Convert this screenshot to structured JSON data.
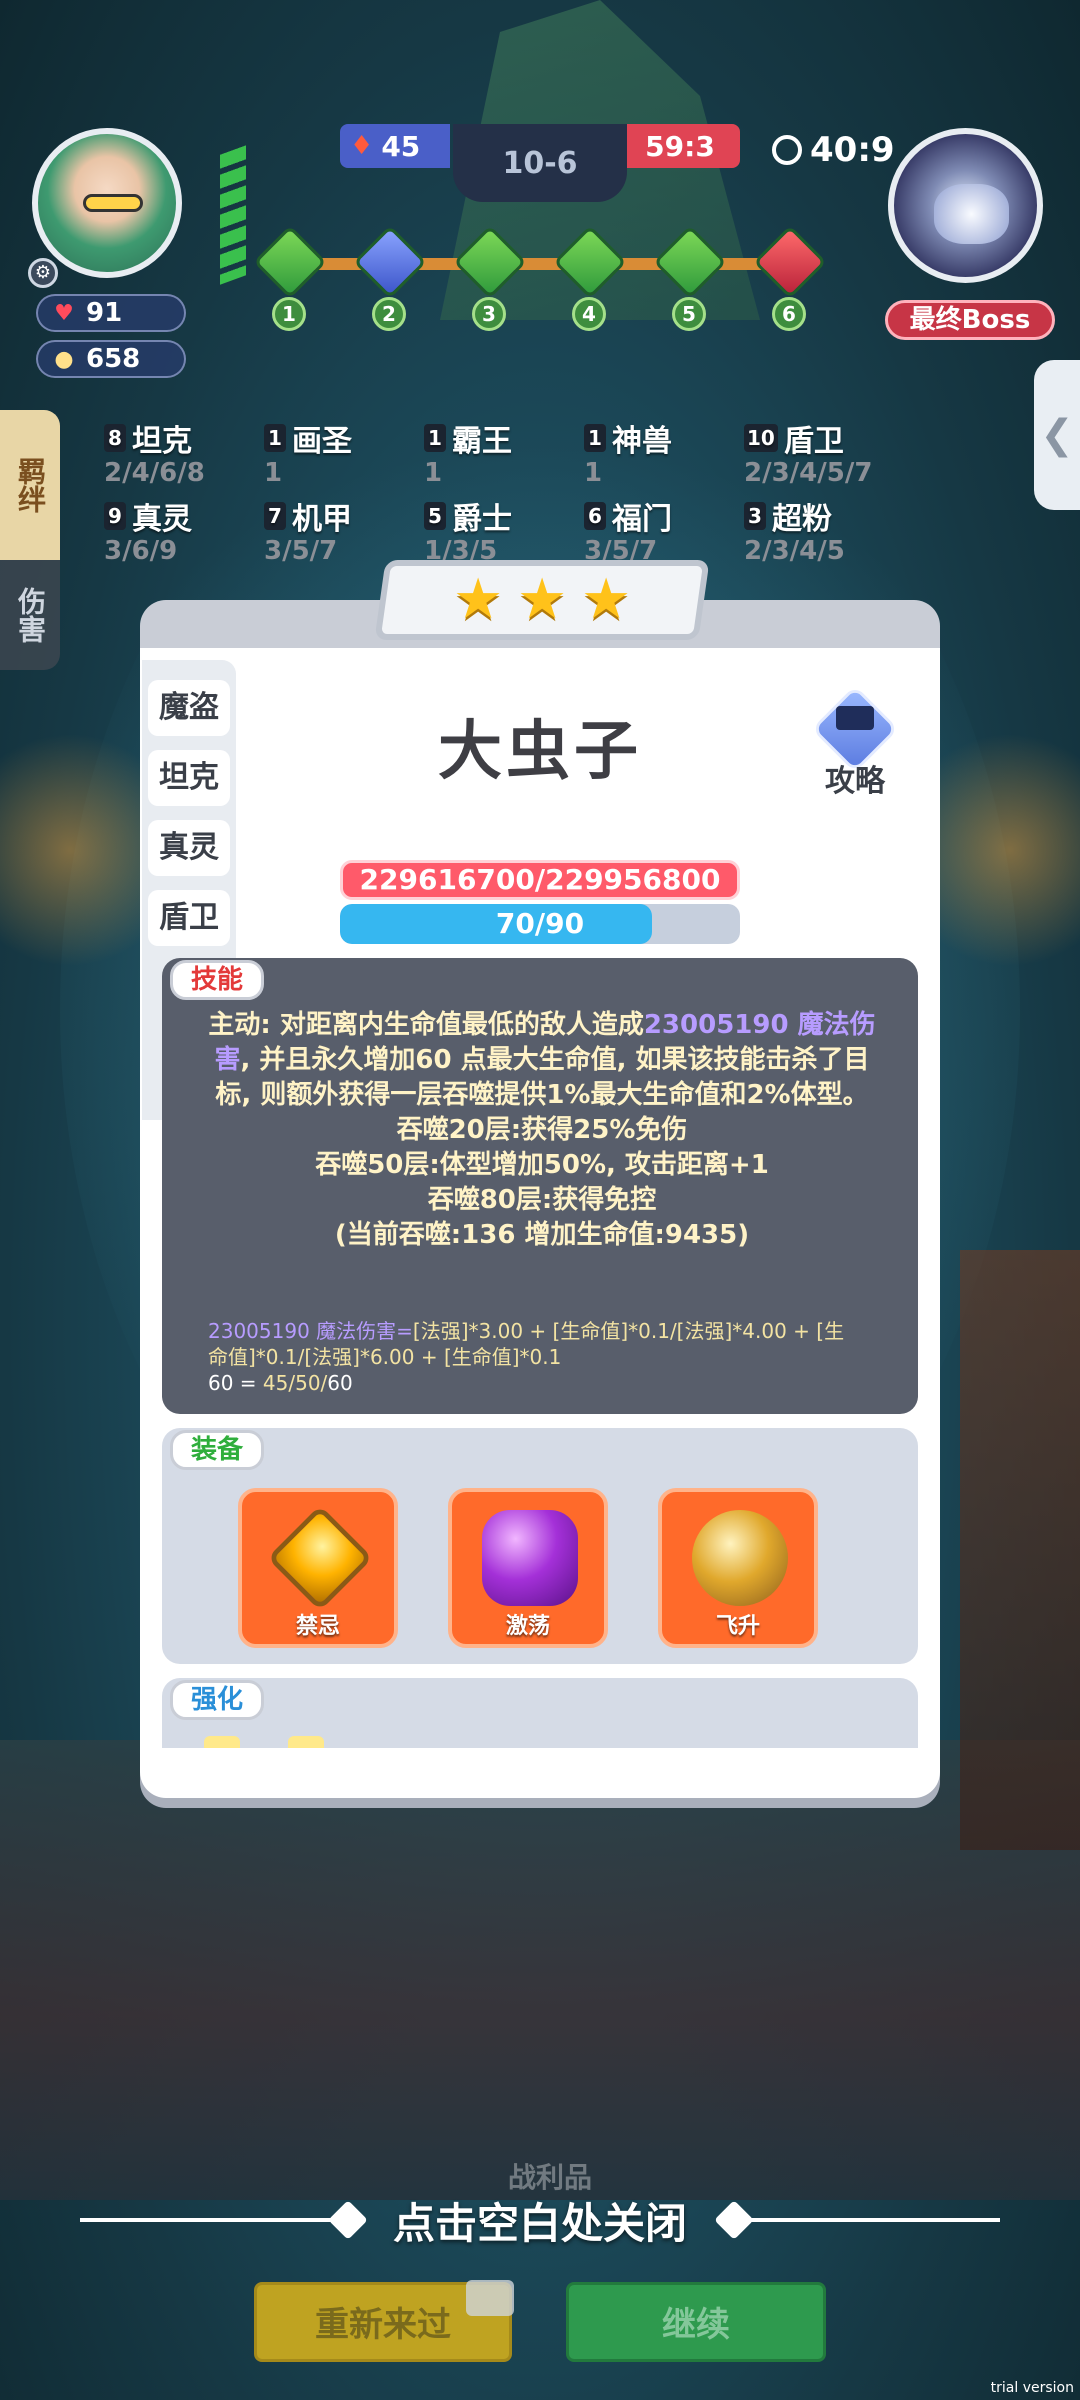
{
  "hud": {
    "player_hp": "91",
    "player_coins": "658",
    "score_left": "45",
    "stage": "10-6",
    "score_right": "59:3",
    "timer": "40:9",
    "boss_label": "最终Boss",
    "path_nodes": [
      "1",
      "2",
      "3",
      "4",
      "5",
      "6"
    ]
  },
  "side_tabs": [
    "羁绊",
    "伤害"
  ],
  "synergies": [
    {
      "count": "8",
      "name": "坦克",
      "tiers": "2/4/6/8"
    },
    {
      "count": "1",
      "name": "画圣",
      "tiers": "1"
    },
    {
      "count": "1",
      "name": "霸王",
      "tiers": "1"
    },
    {
      "count": "1",
      "name": "神兽",
      "tiers": "1"
    },
    {
      "count": "10",
      "name": "盾卫",
      "tiers": "2/3/4/5/7"
    },
    {
      "count": "9",
      "name": "真灵",
      "tiers": "3/6/9"
    },
    {
      "count": "7",
      "name": "机甲",
      "tiers": "3/5/7"
    },
    {
      "count": "5",
      "name": "爵士",
      "tiers": "1/3/5"
    },
    {
      "count": "6",
      "name": "福门",
      "tiers": "3/5/7"
    },
    {
      "count": "3",
      "name": "超粉",
      "tiers": "2/3/4/5"
    }
  ],
  "card": {
    "stars": [
      "★",
      "★",
      "★"
    ],
    "hero_name": "大虫子",
    "guide_label": "攻略",
    "classes": [
      "魔盗",
      "坦克",
      "真灵",
      "盾卫"
    ],
    "hp_text": "229616700/229956800",
    "mp_text": "70/90",
    "mp_fraction": 0.78,
    "skill": {
      "tag": "技能",
      "line1_a": "主动: 对距离内生命值最低的敌人造成",
      "line1_dmg": "23005190 魔法伤害",
      "line1_b": ", 并且永久增加60 点最大生命值, 如果该技能击杀了目标, 则额外获得一层吞噬提供1%最大生命值和2%体型。",
      "line2": "吞噬20层:获得25%免伤",
      "line3": "吞噬50层:体型增加50%, 攻击距离+1",
      "line4": "吞噬80层:获得免控",
      "line5": "(当前吞噬:136 增加生命值:9435)",
      "formula1_a": "23005190 魔法伤害=",
      "formula1_b": "[法强]*3.00 + [生命值]*0.1/[法强]*4.00 + [生命值]*0.1/[法强]*6.00 + [生命值]*0.1",
      "formula2_a": "60 = ",
      "formula2_b": "45/50/",
      "formula2_c": "60"
    },
    "equipment": {
      "tag": "装备",
      "items": [
        "禁忌",
        "激荡",
        "飞升"
      ]
    },
    "enhance": {
      "tag": "强化"
    }
  },
  "bottom": {
    "spoils": "战利品",
    "close_hint": "点击空白处关闭",
    "retry": "重新来过",
    "continue": "继续",
    "watermark": "trial version"
  }
}
